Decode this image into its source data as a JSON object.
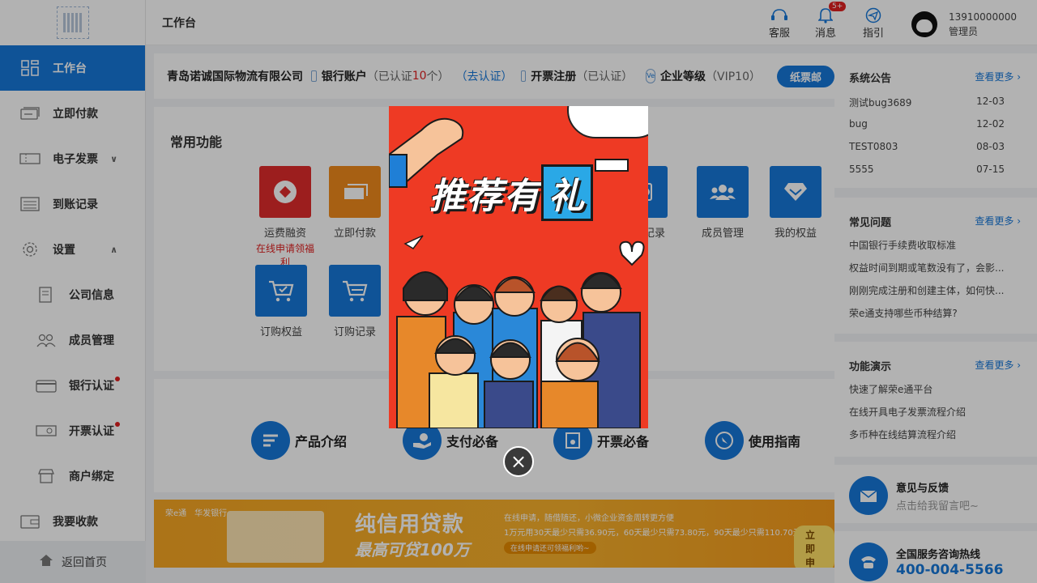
{
  "header": {
    "title": "工作台",
    "service_label": "客服",
    "messages_label": "消息",
    "messages_badge": "5+",
    "guide_label": "指引",
    "user_phone": "13910000000",
    "user_role": "管理员"
  },
  "sidebar": {
    "items": [
      {
        "label": "工作台"
      },
      {
        "label": "立即付款"
      },
      {
        "label": "电子发票"
      },
      {
        "label": "到账记录"
      },
      {
        "label": "设置"
      },
      {
        "label": "公司信息"
      },
      {
        "label": "成员管理"
      },
      {
        "label": "银行认证"
      },
      {
        "label": "开票认证"
      },
      {
        "label": "商户绑定"
      },
      {
        "label": "我要收款"
      }
    ],
    "back_home": "返回首页"
  },
  "infobar": {
    "company": "青岛诺诚国际物流有限公司",
    "bank_label": "银行账户",
    "bank_status_pre": "（已认证",
    "bank_count": "10",
    "bank_status_post": "个）",
    "bank_link": "（去认证）",
    "invoice_label": "开票注册",
    "invoice_status": "（已认证）",
    "vip_icon": "Ve",
    "level_label": "企业等级",
    "level_value": "（VIP10）",
    "paper_btn": "纸票邮"
  },
  "functions": {
    "title": "常用功能",
    "items": [
      {
        "label": "运费融资",
        "sub": "在线申请领福利"
      },
      {
        "label": "立即付款"
      },
      {
        "label": "记录"
      },
      {
        "label": "成员管理"
      },
      {
        "label": "我的权益"
      },
      {
        "label": "订购权益"
      },
      {
        "label": "订购记录"
      }
    ]
  },
  "shortcuts": [
    {
      "label": "产品介绍"
    },
    {
      "label": "支付必备"
    },
    {
      "label": "开票必备"
    },
    {
      "label": "使用指南"
    }
  ],
  "banner": {
    "brand": "荣e通　华发银行",
    "headline": "纯信用贷款",
    "subline": "最高可贷100万",
    "desc1": "在线申请，随借随还，小微企业资金周转更方便",
    "desc2": "1万元用30天最少只需36.90元，60天最少只需73.80元，90天最少只需110.70元",
    "desc3": "在线申请还可领福利哟~",
    "cta": "立即申"
  },
  "right": {
    "notices": {
      "title": "系统公告",
      "more": "查看更多",
      "items": [
        {
          "text": "测试bug3689",
          "date": "12-03"
        },
        {
          "text": "bug",
          "date": "12-02"
        },
        {
          "text": "TEST0803",
          "date": "08-03"
        },
        {
          "text": "5555",
          "date": "07-15"
        }
      ]
    },
    "faq": {
      "title": "常见问题",
      "more": "查看更多",
      "items": [
        {
          "text": "中国银行手续费收取标准"
        },
        {
          "text": "权益时间到期或笔数没有了，会影..."
        },
        {
          "text": "刚刚完成注册和创建主体，如何快..."
        },
        {
          "text": "荣e通支持哪些币种结算?"
        }
      ]
    },
    "demo": {
      "title": "功能演示",
      "more": "查看更多",
      "items": [
        {
          "text": "快速了解荣e通平台"
        },
        {
          "text": "在线开具电子发票流程介绍"
        },
        {
          "text": "多币种在线结算流程介绍"
        }
      ]
    },
    "feedback": {
      "title": "意见与反馈",
      "sub": "点击给我留言吧~"
    },
    "hotline": {
      "title": "全国服务咨询热线",
      "number": "400-004-5566"
    }
  },
  "popup": {
    "headline": "推荐有",
    "highlight": "礼",
    "close_glyph": "×"
  },
  "colors": {
    "primary": "#1677d9",
    "alert": "#e02020",
    "popup_bg": "#ee3a24",
    "banner": "#f6a623"
  }
}
